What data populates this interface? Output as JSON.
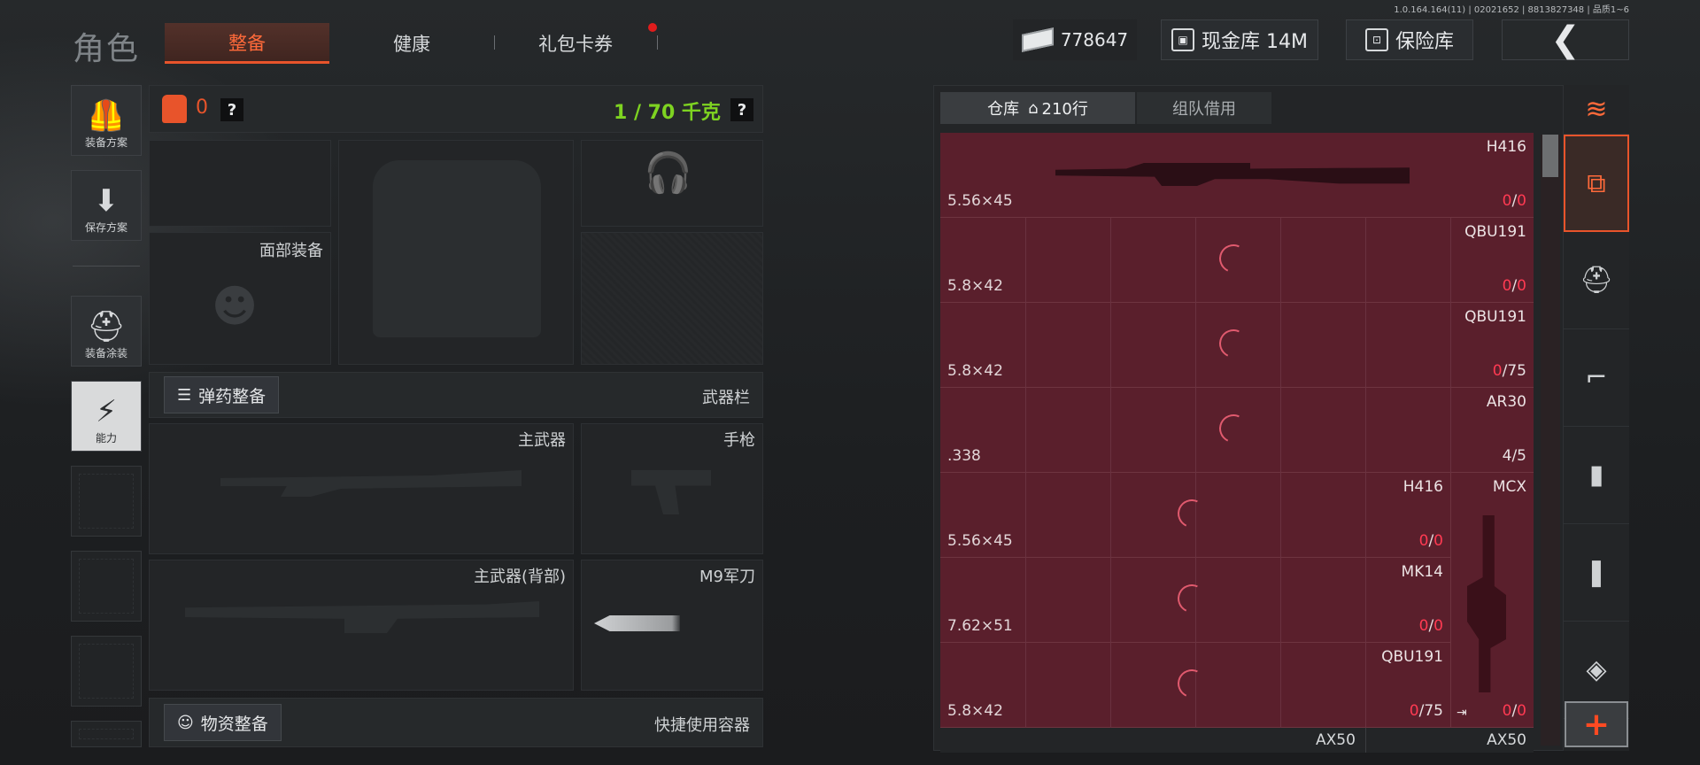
{
  "version": "1.0.164.164(11) | 02021652 | 8813827348 | 品质1~6",
  "title": "角色",
  "tabs": [
    {
      "label": "整备"
    },
    {
      "label": "健康"
    },
    {
      "label": "礼包卡券"
    }
  ],
  "currency": {
    "amount": "778647"
  },
  "cash_vault": {
    "label": "现金库 14M"
  },
  "safe": {
    "label": "保险库"
  },
  "side": {
    "loadout": "装备方案",
    "save": "保存方案",
    "skin": "装备涂装",
    "ability": "能力"
  },
  "equip": {
    "armor_count": "0",
    "weight": "1 / 70 千克",
    "help": "?",
    "face_gear": "面部装备",
    "ammo_loadout": "弹药整备",
    "weapon_bar": "武器栏",
    "primary": "主武器",
    "pistol": "手枪",
    "primary_back": "主武器(背部)",
    "knife": "M9军刀",
    "supply_loadout": "物资整备",
    "quick_container": "快捷使用容器"
  },
  "warehouse": {
    "tab_label": "仓库",
    "rows": "210行",
    "team_borrow": "组队借用",
    "items": [
      {
        "name": "H416",
        "cal": "5.56×45",
        "ammo_a": "0",
        "ammo_b": "0"
      },
      {
        "name": "QBU191",
        "cal": "5.8×42",
        "ammo_a": "0",
        "ammo_b": "0"
      },
      {
        "name": "QBU191",
        "cal": "5.8×42",
        "ammo_a": "0",
        "ammo_b": "75"
      },
      {
        "name": "AR30",
        "cal": ".338",
        "ammo_a": "4",
        "ammo_b": "5"
      },
      {
        "name": "H416",
        "cal": "5.56×45",
        "ammo_a": "0",
        "ammo_b": "0"
      },
      {
        "name": "MK14",
        "cal": "7.62×51",
        "ammo_a": "0",
        "ammo_b": "0"
      },
      {
        "name": "QBU191",
        "cal": "5.8×42",
        "ammo_a": "0",
        "ammo_b": "75"
      }
    ],
    "side_item": {
      "name": "MCX",
      "ammo_a": "0",
      "ammo_b": "0"
    },
    "bottom_left": "AX50",
    "bottom_right": "AX50",
    "sep": "/"
  },
  "colors": {
    "accent": "#e8542b",
    "weight_ok": "#7ed321",
    "warn_red": "#ff3a52"
  }
}
